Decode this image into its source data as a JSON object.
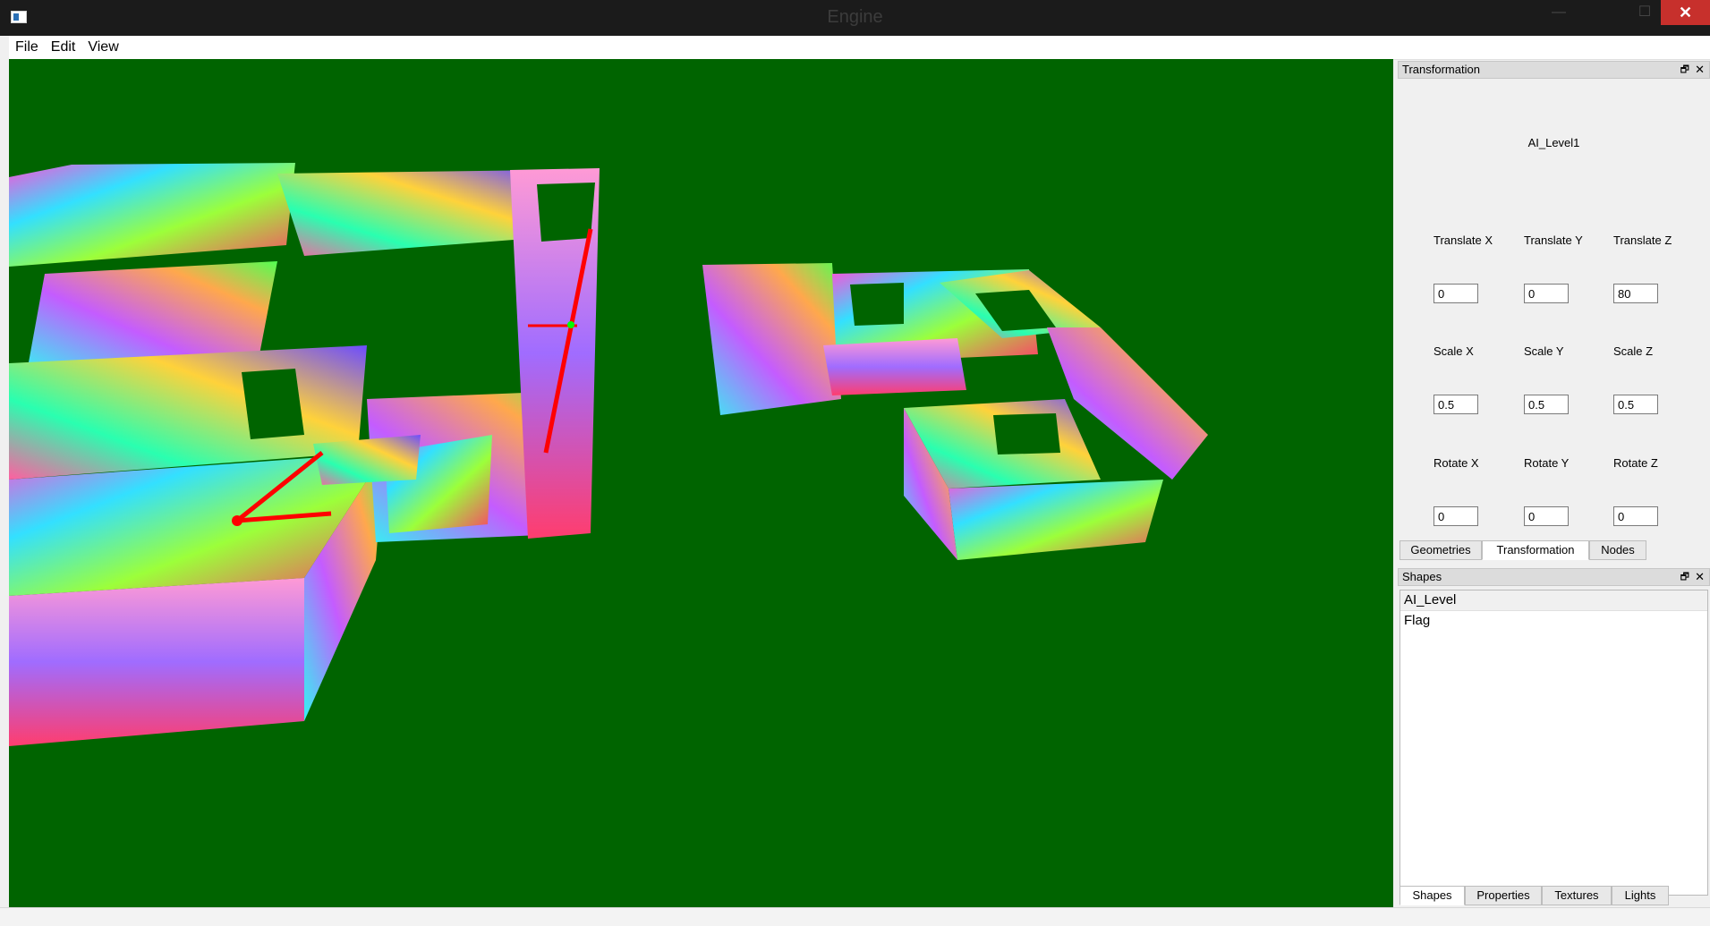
{
  "window": {
    "title": "Engine",
    "min_icon": "minimize-icon",
    "max_icon": "maximize-icon",
    "close_glyph": "✕"
  },
  "menu": {
    "items": [
      "File",
      "Edit",
      "View"
    ]
  },
  "transformation_panel": {
    "title": "Transformation",
    "float_glyph": "🗗",
    "close_glyph": "✕",
    "object_name": "AI_Level1",
    "fields": {
      "translate_x": {
        "label": "Translate X",
        "value": "0"
      },
      "translate_y": {
        "label": "Translate Y",
        "value": "0"
      },
      "translate_z": {
        "label": "Translate Z",
        "value": "80"
      },
      "scale_x": {
        "label": "Scale X",
        "value": "0.5"
      },
      "scale_y": {
        "label": "Scale Y",
        "value": "0.5"
      },
      "scale_z": {
        "label": "Scale Z",
        "value": "0.5"
      },
      "rotate_x": {
        "label": "Rotate X",
        "value": "0"
      },
      "rotate_y": {
        "label": "Rotate Y",
        "value": "0"
      },
      "rotate_z": {
        "label": "Rotate Z",
        "value": "0"
      }
    },
    "tabs": [
      "Geometries",
      "Transformation",
      "Nodes"
    ],
    "active_tab": "Transformation"
  },
  "shapes_panel": {
    "title": "Shapes",
    "float_glyph": "🗗",
    "close_glyph": "✕",
    "items": [
      "AI_Level",
      "Flag"
    ],
    "tabs": [
      "Shapes",
      "Properties",
      "Textures",
      "Lights"
    ],
    "active_tab": "Shapes"
  },
  "colors": {
    "viewport_bg": "#006400",
    "close_button": "#c7302c",
    "gizmo": "#ff0000"
  }
}
